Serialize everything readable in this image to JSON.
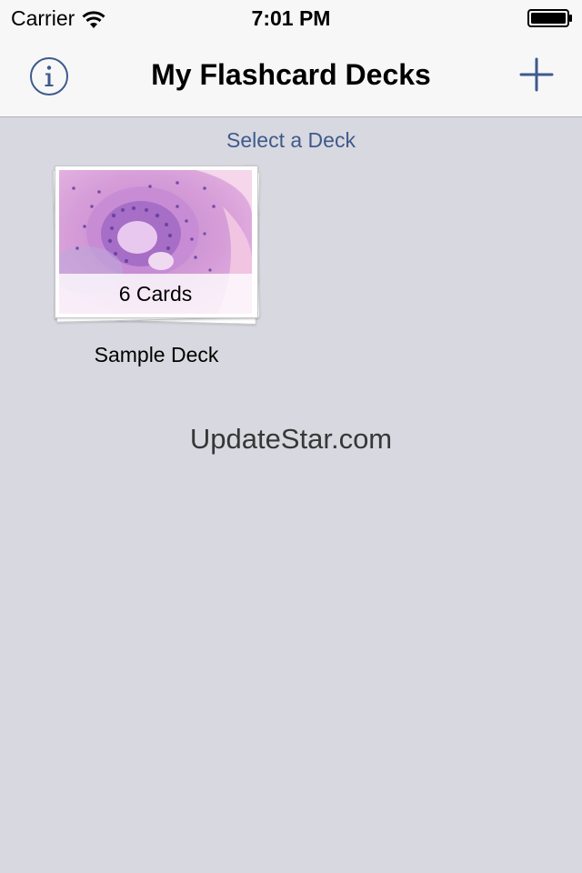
{
  "status_bar": {
    "carrier": "Carrier",
    "time": "7:01 PM",
    "signal_icon": "wifi-icon",
    "battery_icon": "battery-icon"
  },
  "nav_bar": {
    "title": "My Flashcard Decks",
    "left_icon": "info-icon",
    "right_icon": "plus-icon"
  },
  "main": {
    "section_header": "Select a Deck",
    "decks": [
      {
        "name": "Sample Deck",
        "count_label": "6 Cards",
        "thumbnail": "histology-slide-image"
      }
    ]
  },
  "watermark": "UpdateStar.com",
  "colors": {
    "accent": "#3d5a8c",
    "background": "#d8d8e0",
    "bar_background": "#f7f7f8"
  }
}
